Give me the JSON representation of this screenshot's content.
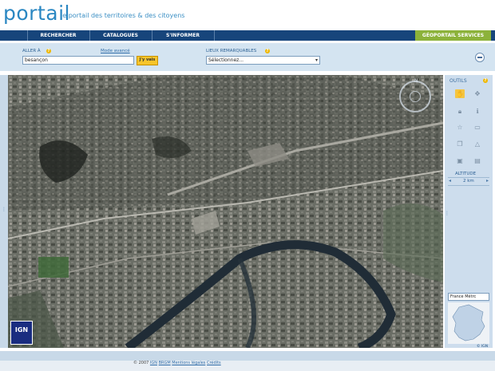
{
  "header": {
    "logo": "portail",
    "tagline": "le portail des territoires & des citoyens"
  },
  "nav": {
    "items": [
      {
        "label": "RECHERCHER"
      },
      {
        "label": "CATALOGUES"
      },
      {
        "label": "S'INFORMER"
      }
    ],
    "services_label": "GÉOPORTAIL SERVICES"
  },
  "search": {
    "aller_label": "ALLER À",
    "help": "?",
    "mode_link": "Mode avancé",
    "value": "besançon",
    "go_label": "J'y vais",
    "lieux_label": "LIEUX REMARQUABLES",
    "select_value": "Sélectionnez..."
  },
  "tools": {
    "title": "OUTILS",
    "help": "?",
    "altitude_label": "ALTITUDE",
    "altitude_value": "2 km",
    "minimap_select": "France Métrc",
    "ign_small": "© IGN"
  },
  "map": {
    "ign_badge": "IGN"
  },
  "footer": {
    "copyright": "© 2007",
    "links": [
      "IGN",
      "BRGM",
      "Mentions légales",
      "Crédits"
    ]
  }
}
